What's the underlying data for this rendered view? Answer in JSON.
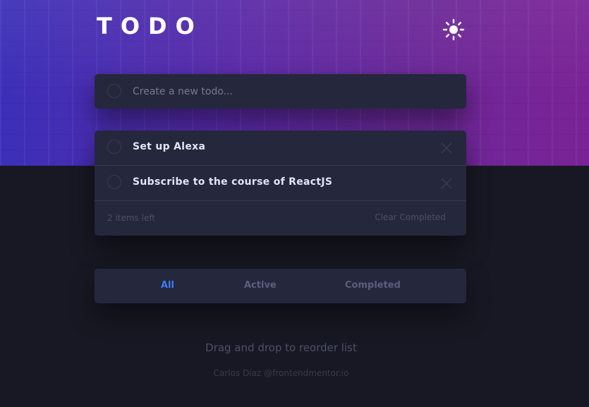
{
  "header": {
    "title": "TODO",
    "theme_icon": "sun-icon"
  },
  "new_todo": {
    "placeholder": "Create a new todo..."
  },
  "todos": [
    {
      "text": "Set up Alexa",
      "completed": false
    },
    {
      "text": "Subscribe to the course of ReactJS",
      "completed": false
    }
  ],
  "list_footer": {
    "items_left": "2 items left",
    "clear_label": "Clear Completed"
  },
  "filters": {
    "all": "All",
    "active": "Active",
    "completed": "Completed",
    "selected": "all"
  },
  "footer": {
    "hint": "Drag and drop to reorder list",
    "credit": "Carlos Díaz @frontendmentor.io"
  },
  "colors": {
    "background": "#171823",
    "card": "#25273d",
    "accent": "#3a7cfd",
    "hero_start": "#3b2fb8",
    "hero_end": "#7a2296"
  }
}
